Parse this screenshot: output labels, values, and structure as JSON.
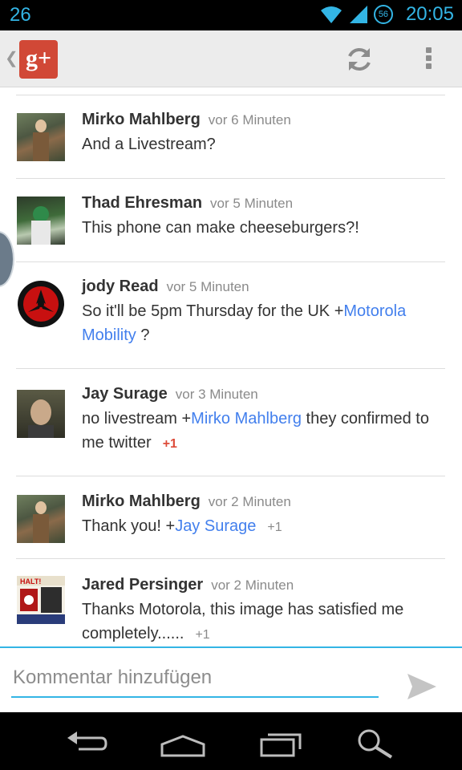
{
  "status_bar": {
    "notification_count": "26",
    "network_badge": "56",
    "time": "20:05"
  },
  "action_bar": {
    "app_logo": "g+",
    "up_icon": "chevron-left-icon",
    "refresh_icon": "refresh-icon",
    "overflow_icon": "overflow-menu-icon"
  },
  "comments": [
    {
      "author": "Mirko Mahlberg",
      "time": "vor 6 Minuten",
      "text": "And a Livestream?"
    },
    {
      "author": "Thad Ehresman",
      "time": "vor 5 Minuten",
      "text": "This phone can make cheeseburgers?!"
    },
    {
      "author": "jody Read",
      "time": "vor 5 Minuten",
      "text_prefix": "So it'll be 5pm Thursday for the UK +",
      "mention": "Motorola Mobility",
      "text_suffix": " ?"
    },
    {
      "author": "Jay Surage",
      "time": "vor 3 Minuten",
      "text_prefix": "no livestream +",
      "mention": "Mirko Mahlberg",
      "text_suffix": " they confirmed to me twitter",
      "plus_one": "+1"
    },
    {
      "author": "Mirko Mahlberg",
      "time": "vor 2 Minuten",
      "text_prefix": "Thank you! +",
      "mention": "Jay Surage",
      "plus_one": "+1"
    },
    {
      "author": "Jared Persinger",
      "time": "vor 2 Minuten",
      "text": "Thanks Motorola, this image has satisfied me completely......",
      "plus_one": "+1",
      "avatar_text": "HALT!"
    }
  ],
  "input": {
    "placeholder": "Kommentar hinzufügen"
  },
  "colors": {
    "accent": "#33b5e5",
    "link": "#427fed",
    "plus_one_active": "#dd4b39",
    "gplus_red": "#d14836"
  },
  "nav_bar": {
    "back_icon": "back-icon",
    "home_icon": "home-icon",
    "recents_icon": "recent-apps-icon",
    "search_icon": "search-icon"
  }
}
